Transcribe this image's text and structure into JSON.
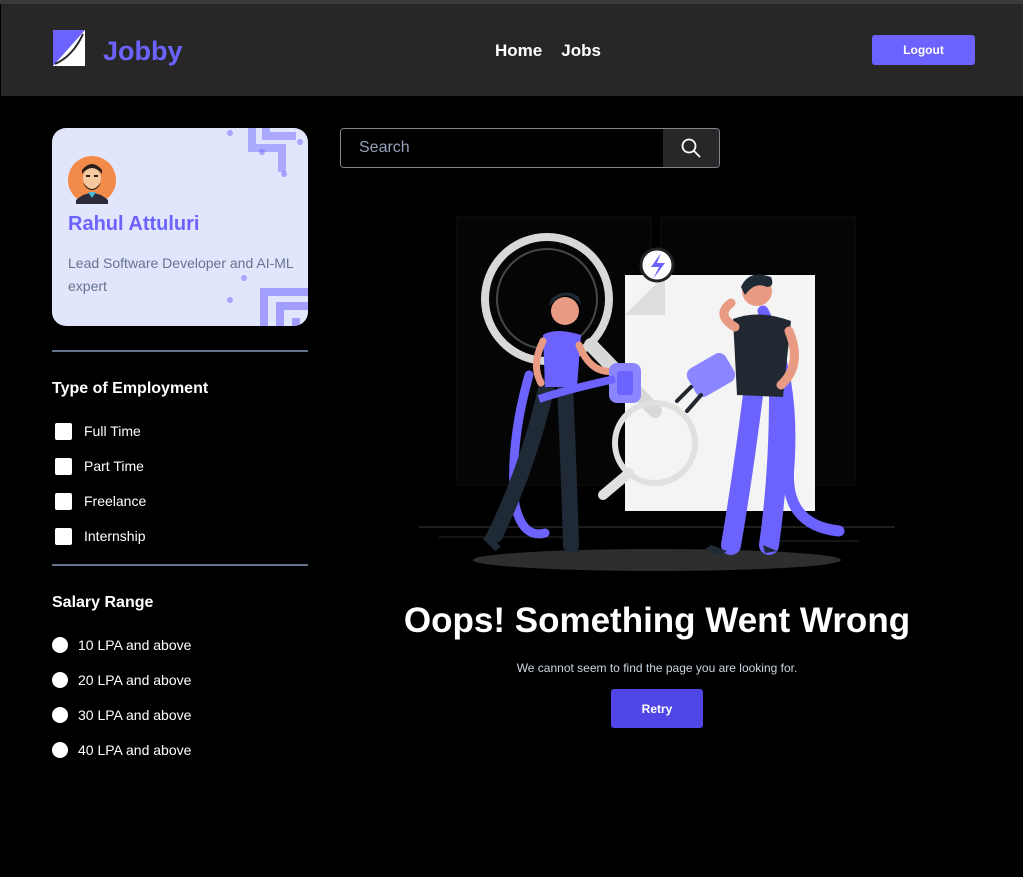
{
  "header": {
    "brand": "Jobby",
    "nav": [
      "Home",
      "Jobs"
    ],
    "logout_label": "Logout",
    "logo_icon": "jobby-logo-icon"
  },
  "profile": {
    "name": "Rahul Attuluri",
    "bio": "Lead Software Developer and AI-ML expert",
    "avatar_icon": "avatar-icon"
  },
  "filters": {
    "employment_title": "Type of Employment",
    "employment_types": [
      "Full Time",
      "Part Time",
      "Freelance",
      "Internship"
    ],
    "salary_title": "Salary Range",
    "salary_ranges": [
      "10 LPA and above",
      "20 LPA and above",
      "30 LPA and above",
      "40 LPA and above"
    ]
  },
  "search": {
    "placeholder": "Search",
    "value": "",
    "icon": "search-icon"
  },
  "failure": {
    "title": "Oops! Something Went Wrong",
    "description": "We cannot seem to find the page you are looking for.",
    "retry_label": "Retry",
    "illustration": "failure-illustration"
  },
  "colors": {
    "accent": "#6c63ff",
    "retry": "#4f46e5",
    "navbar": "#272727",
    "card": "#e2e6fd",
    "background": "#000000"
  }
}
